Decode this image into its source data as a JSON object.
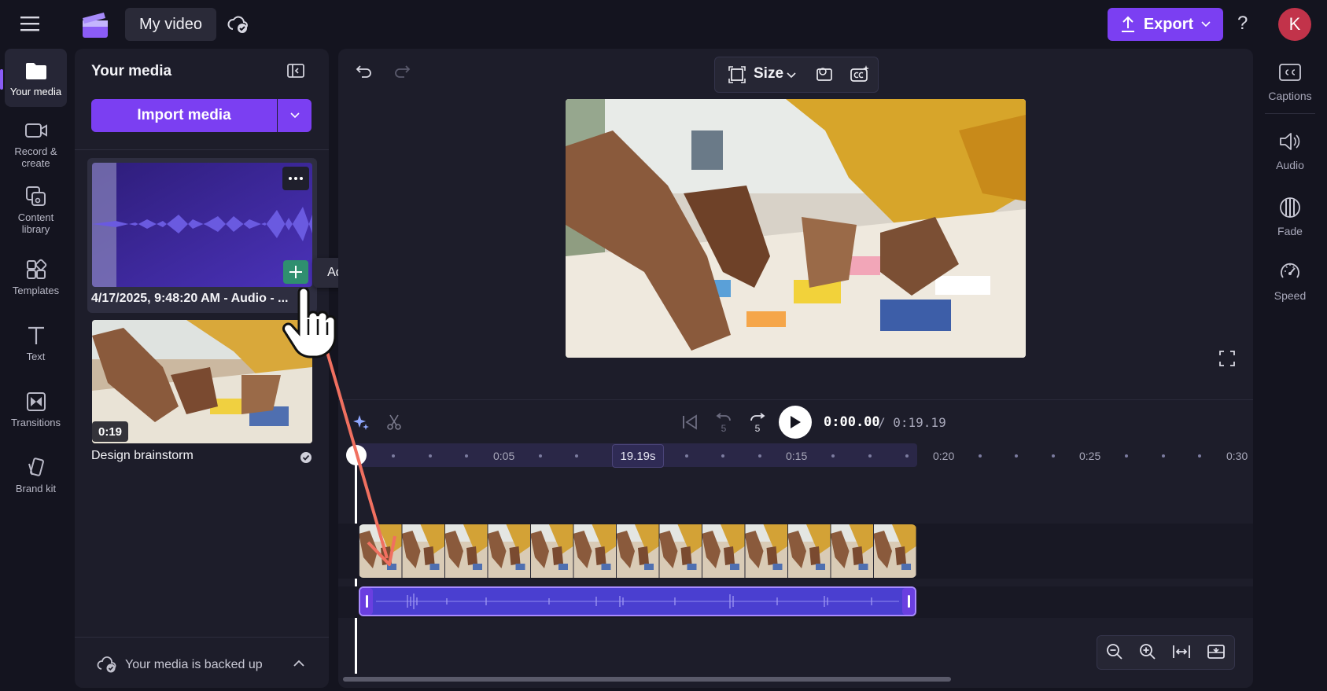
{
  "app": {
    "project_title": "My video",
    "export_label": "Export",
    "help_label": "?",
    "avatar_initial": "K",
    "accent_color": "#7b3ff2"
  },
  "left_rail": [
    {
      "label": "Your media",
      "icon": "folder-icon",
      "active": true
    },
    {
      "label": "Record & create",
      "icon": "camera-icon"
    },
    {
      "label": "Content library",
      "icon": "content-library-icon"
    },
    {
      "label": "Templates",
      "icon": "templates-icon"
    },
    {
      "label": "Text",
      "icon": "text-icon"
    },
    {
      "label": "Transitions",
      "icon": "transitions-icon"
    },
    {
      "label": "Brand kit",
      "icon": "brand-kit-icon"
    }
  ],
  "media_panel": {
    "title": "Your media",
    "import_label": "Import media",
    "items": [
      {
        "label": "4/17/2025, 9:48:20 AM - Audio - ...",
        "type": "audio"
      },
      {
        "label": "Design brainstorm",
        "duration": "0:19",
        "type": "video"
      }
    ],
    "tooltip": "Add to timeline",
    "backup_status": "Your media is backed up"
  },
  "stage_toolbar": {
    "size_label": "Size"
  },
  "playback": {
    "current_time": "0:00.00",
    "total_time": "/ 0:19.19",
    "skip_back_seconds": "5",
    "skip_forward_seconds": "5"
  },
  "timeline": {
    "ruler_labels": [
      "0:05",
      "0:15",
      "0:20",
      "0:25",
      "0:30"
    ],
    "duration_marker": "19.19s"
  },
  "right_rail": [
    {
      "label": "Captions",
      "icon": "captions-icon"
    },
    {
      "label": "Audio",
      "icon": "speaker-icon"
    },
    {
      "label": "Fade",
      "icon": "fade-icon"
    },
    {
      "label": "Speed",
      "icon": "speedometer-icon"
    }
  ]
}
